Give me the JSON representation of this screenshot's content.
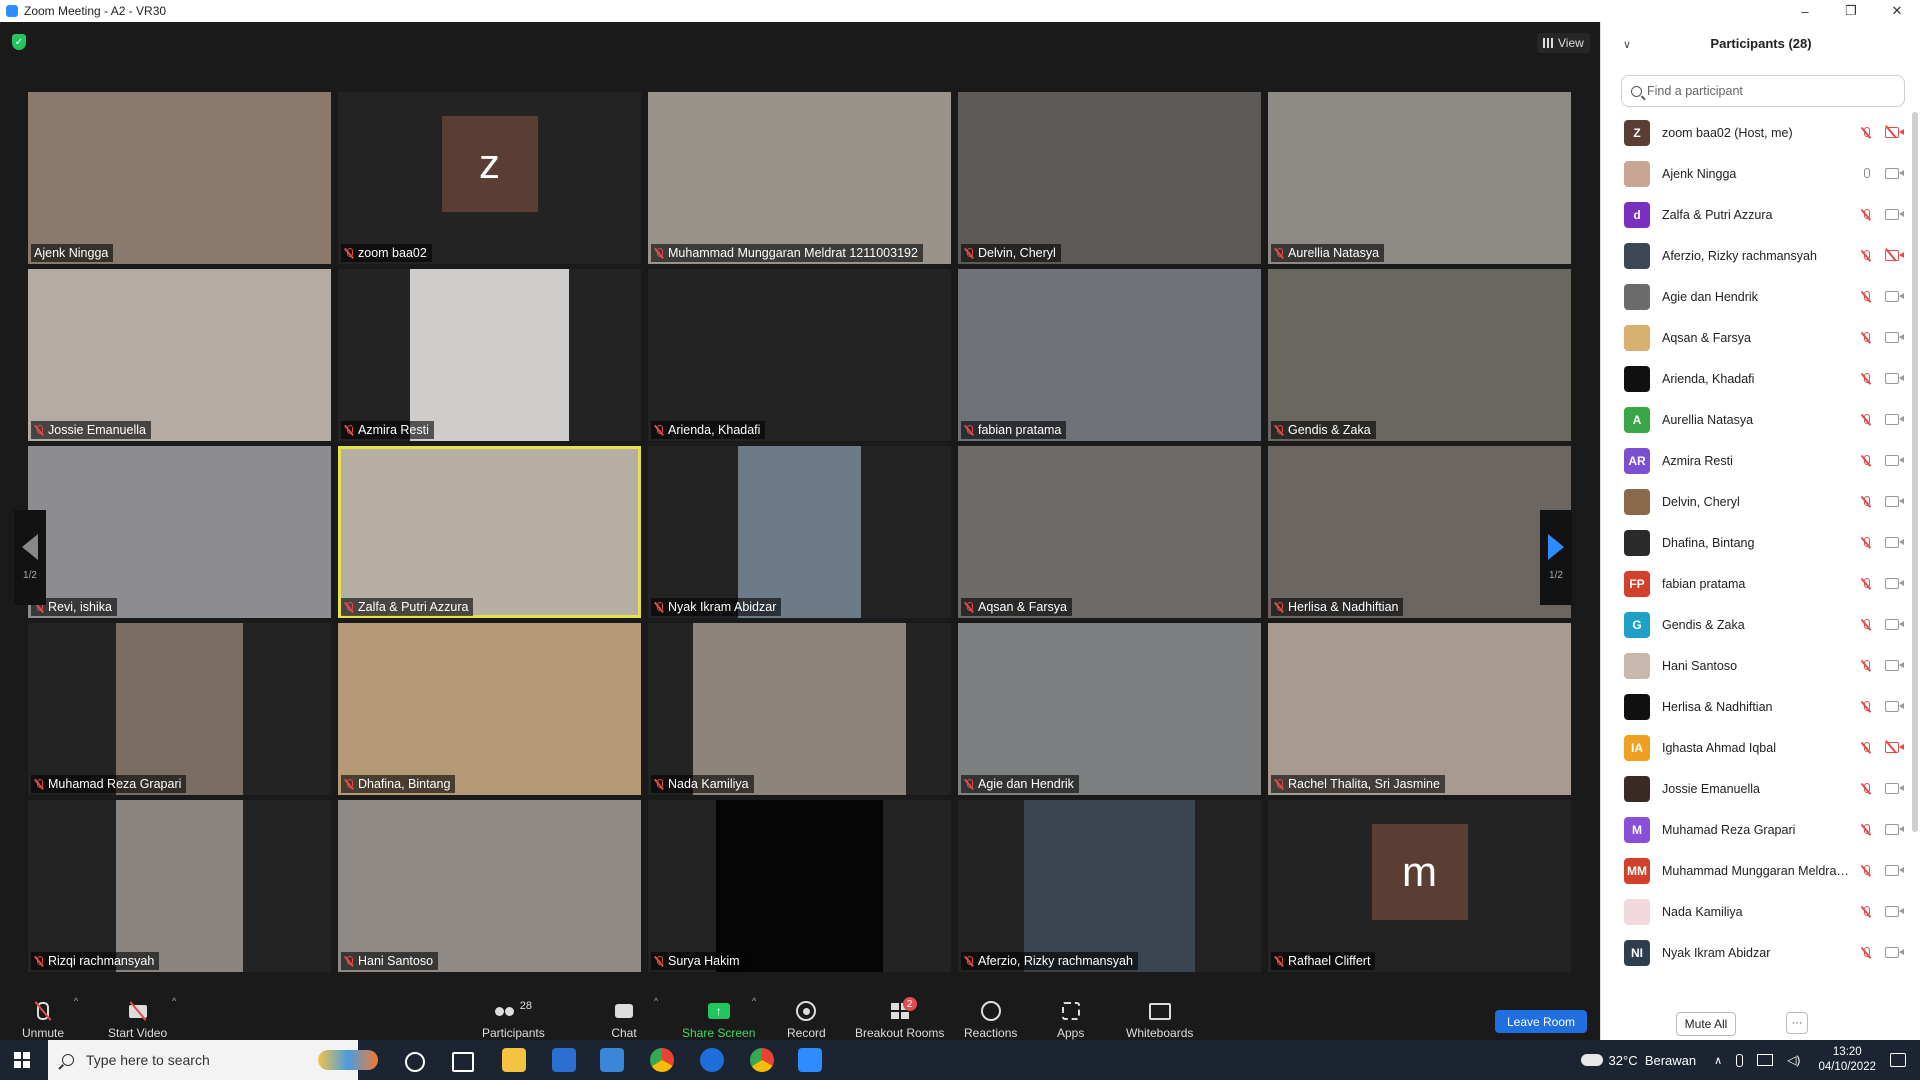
{
  "window": {
    "title": "Zoom Meeting - A2 - VR30",
    "controls": [
      "–",
      "❐",
      "✕"
    ]
  },
  "view_label": "View",
  "page_indicator": "1/2",
  "tiles": [
    {
      "name": "Ajenk Ningga",
      "muted": false,
      "bg": "#8a7a6e",
      "vl": 0,
      "vr": 0
    },
    {
      "name": "zoom baa02",
      "muted": true,
      "bg": "#232323",
      "avatar": "z",
      "avatar_color": "#5a3d33"
    },
    {
      "name": "Muhammad Munggaran Meldrat 1211003192",
      "muted": true,
      "bg": "#9a938c"
    },
    {
      "name": "Delvin, Cheryl",
      "muted": true,
      "bg": "#5d5a57"
    },
    {
      "name": "Aurellia Natasya",
      "muted": true,
      "bg": "#8e8a86"
    },
    {
      "name": "Jossie Emanuella",
      "muted": true,
      "bg": "#b4aba5"
    },
    {
      "name": "Azmira Resti",
      "muted": true,
      "bg": "#232323",
      "vl": 72,
      "vr": 72,
      "vbg": "#cfcdcb"
    },
    {
      "name": "Arienda, Khadafi",
      "muted": true,
      "bg": "#232323"
    },
    {
      "name": "fabian pratama",
      "muted": true,
      "bg": "#6f7278"
    },
    {
      "name": "Gendis & Zaka",
      "muted": true,
      "bg": "#6a6660"
    },
    {
      "name": "Revi, ishika",
      "muted": true,
      "bg": "#8d8d91"
    },
    {
      "name": "Zalfa & Putri Azzura",
      "muted": true,
      "bg": "#b7aea4",
      "active": true
    },
    {
      "name": "Nyak Ikram Abidzar",
      "muted": true,
      "bg": "#232323",
      "vl": 90,
      "vr": 90,
      "vbg": "#6d7a88"
    },
    {
      "name": "Aqsan & Farsya",
      "muted": true,
      "bg": "#6d6a68"
    },
    {
      "name": "Herlisa & Nadhiftian",
      "muted": true,
      "bg": "#6c6663"
    },
    {
      "name": "Muhamad Reza Grapari",
      "muted": true,
      "bg": "#232323",
      "vl": 88,
      "vr": 88,
      "vbg": "#7a6e62"
    },
    {
      "name": "Dhafina, Bintang",
      "muted": true,
      "bg": "#b69a78"
    },
    {
      "name": "Nada Kamiliya",
      "muted": true,
      "bg": "#232323",
      "vl": 45,
      "vr": 45,
      "vbg": "#8d847c"
    },
    {
      "name": "Agie dan Hendrik",
      "muted": true,
      "bg": "#7e7f80"
    },
    {
      "name": "Rachel Thalita, Sri Jasmine",
      "muted": true,
      "bg": "#a89a90"
    },
    {
      "name": "Rizqi rachmansyah",
      "muted": true,
      "bg": "#232323",
      "vl": 88,
      "vr": 88,
      "vbg": "#8a8581"
    },
    {
      "name": "Hani Santoso",
      "muted": true,
      "bg": "#8f8a86"
    },
    {
      "name": "Surya Hakim",
      "muted": true,
      "bg": "#232323",
      "vl": 68,
      "vr": 68,
      "vbg": "#050505"
    },
    {
      "name": "Aferzio, Rizky rachmansyah",
      "muted": true,
      "bg": "#232323",
      "vl": 66,
      "vr": 66,
      "vbg": "#3b4552"
    },
    {
      "name": "Rafhael Cliffert",
      "muted": true,
      "bg": "#232323",
      "avatar": "m",
      "avatar_color": "#5a3d33"
    }
  ],
  "toolbar": {
    "unmute": "Unmute",
    "start_video": "Start Video",
    "participants": "Participants",
    "participants_count": "28",
    "chat": "Chat",
    "share_screen": "Share Screen",
    "record": "Record",
    "breakout_rooms": "Breakout Rooms",
    "breakout_badge": "2",
    "reactions": "Reactions",
    "apps": "Apps",
    "whiteboards": "Whiteboards",
    "leave_room": "Leave Room"
  },
  "panel": {
    "title": "Participants (28)",
    "search_placeholder": "Find a participant",
    "mute_all": "Mute All",
    "more": "···",
    "participants": [
      {
        "name": "zoom baa02 (Host, me)",
        "initial": "Z",
        "color": "#5a3d33",
        "mic": "off",
        "cam": "off"
      },
      {
        "name": "Ajenk Ningga",
        "initial": "",
        "color": "#c9a594",
        "mic": "on",
        "cam": "on"
      },
      {
        "name": "Zalfa & Putri Azzura",
        "initial": "d",
        "color": "#7a2fbf",
        "mic": "off",
        "cam": "on"
      },
      {
        "name": "Aferzio, Rizky rachmansyah",
        "initial": "",
        "color": "#3d4755",
        "mic": "off",
        "cam": "off"
      },
      {
        "name": "Agie dan Hendrik",
        "initial": "",
        "color": "#6b6b6b",
        "mic": "off",
        "cam": "on"
      },
      {
        "name": "Aqsan & Farsya",
        "initial": "",
        "color": "#d8b070",
        "mic": "off",
        "cam": "on"
      },
      {
        "name": "Arienda, Khadafi",
        "initial": "",
        "color": "#111111",
        "mic": "off",
        "cam": "on"
      },
      {
        "name": "Aurellia Natasya",
        "initial": "A",
        "color": "#3aa64a",
        "mic": "off",
        "cam": "on"
      },
      {
        "name": "Azmira Resti",
        "initial": "AR",
        "color": "#7a4fd0",
        "mic": "off",
        "cam": "on"
      },
      {
        "name": "Delvin, Cheryl",
        "initial": "",
        "color": "#8a6a4a",
        "mic": "off",
        "cam": "on"
      },
      {
        "name": "Dhafina, Bintang",
        "initial": "",
        "color": "#2b2b2b",
        "mic": "off",
        "cam": "on"
      },
      {
        "name": "fabian pratama",
        "initial": "FP",
        "color": "#d2402a",
        "mic": "off",
        "cam": "on"
      },
      {
        "name": "Gendis & Zaka",
        "initial": "G",
        "color": "#1ea0c8",
        "mic": "off",
        "cam": "on"
      },
      {
        "name": "Hani Santoso",
        "initial": "",
        "color": "#c7b7ad",
        "mic": "off",
        "cam": "on"
      },
      {
        "name": "Herlisa & Nadhiftian",
        "initial": "",
        "color": "#111111",
        "mic": "off",
        "cam": "on"
      },
      {
        "name": "Ighasta Ahmad Iqbal",
        "initial": "IA",
        "color": "#f0a020",
        "mic": "off",
        "cam": "off"
      },
      {
        "name": "Jossie Emanuella",
        "initial": "",
        "color": "#3a2a25",
        "mic": "off",
        "cam": "on"
      },
      {
        "name": "Muhamad Reza Grapari",
        "initial": "M",
        "color": "#8a4fd8",
        "mic": "off",
        "cam": "on"
      },
      {
        "name": "Muhammad Munggaran Meldrat 1211003192",
        "initial": "MM",
        "color": "#d2402a",
        "mic": "off",
        "cam": "on"
      },
      {
        "name": "Nada Kamiliya",
        "initial": "",
        "color": "#f2d8dc",
        "mic": "off",
        "cam": "on"
      },
      {
        "name": "Nyak Ikram Abidzar",
        "initial": "NI",
        "color": "#2e3e50",
        "mic": "off",
        "cam": "on"
      }
    ]
  },
  "taskbar": {
    "search_placeholder": "Type here to search",
    "weather": "32°C  Berawan",
    "time": "13:20",
    "date": "04/10/2022"
  }
}
